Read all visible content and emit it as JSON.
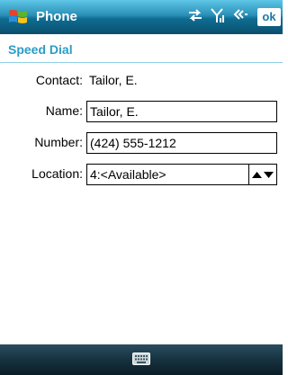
{
  "window": {
    "title": "Phone",
    "ok_label": "ok"
  },
  "status_icons": [
    "connectivity-arrows-icon",
    "signal-antenna-icon",
    "speaker-volume-icon"
  ],
  "section": {
    "title": "Speed Dial"
  },
  "form": {
    "contact_label": "Contact:",
    "contact_value": "Tailor, E.",
    "name_label": "Name:",
    "name_value": "Tailor, E.",
    "number_label": "Number:",
    "number_value": "(424) 555-1212",
    "location_label": "Location:",
    "location_value": "4:<Available>"
  },
  "bottom_bar": {
    "icon": "keyboard-icon"
  },
  "colors": {
    "accent": "#2a9cc6",
    "titlebar": "#1b7aa6",
    "bottombar": "#16323f"
  }
}
